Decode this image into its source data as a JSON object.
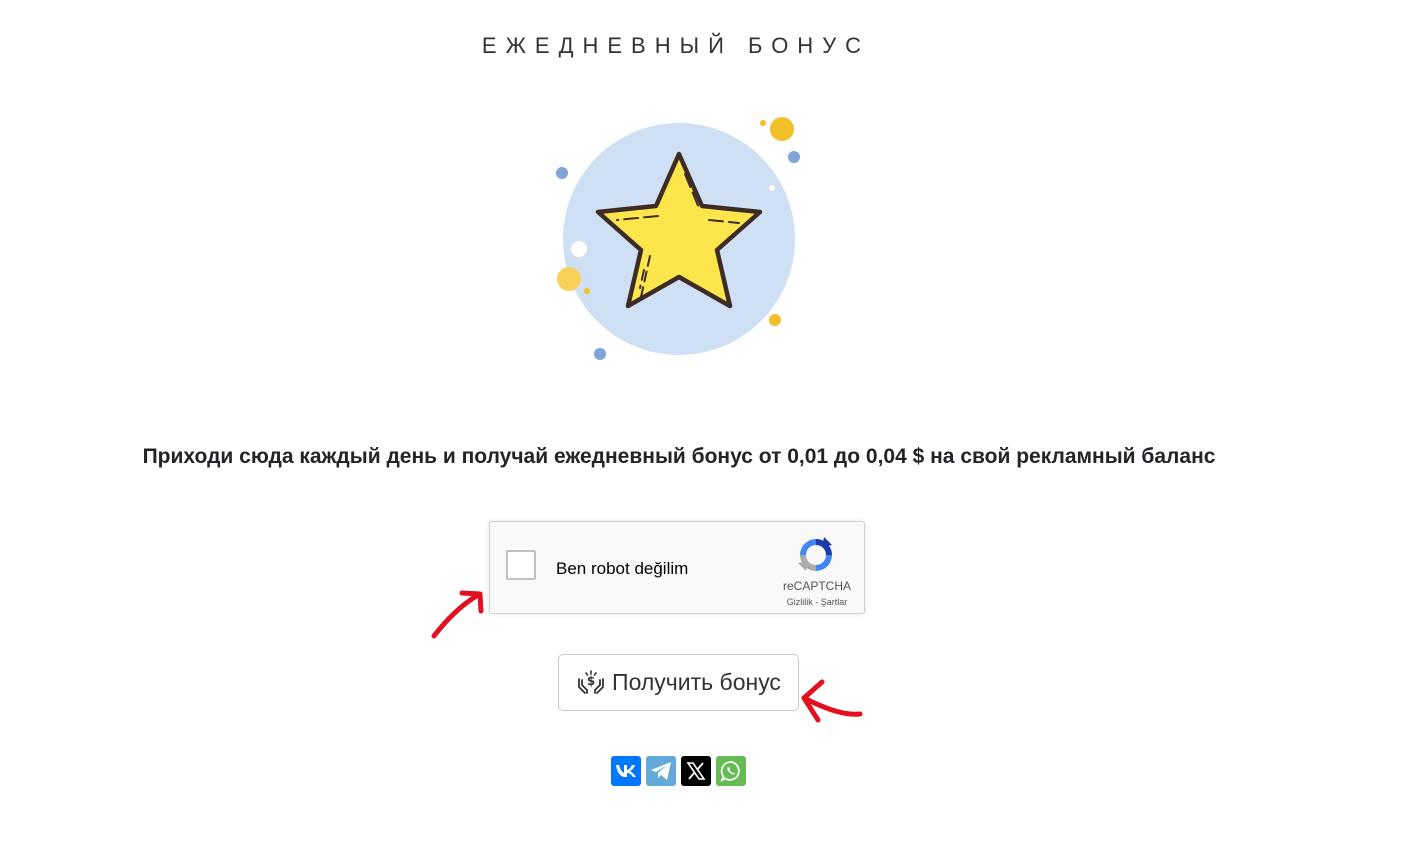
{
  "page": {
    "title": "ЕЖЕДНЕВНЫЙ БОНУС",
    "description": "Приходи сюда каждый день и получай ежедневный бонус от 0,01 до 0,04 $ на свой рекламный баланс"
  },
  "illustration": {
    "icon": "star-icon",
    "circle_color": "#cfe0f5",
    "star_color": "#fde64b",
    "dot_colors": [
      "#f4c02a",
      "#7fa6d6",
      "#ffffff"
    ]
  },
  "recaptcha": {
    "label": "Ben robot değilim",
    "brand": "reCAPTCHA",
    "privacy": "Gizlilik",
    "separator": " - ",
    "terms": "Şartlar"
  },
  "bonus_button": {
    "label": "Получить бонус",
    "icon": "hands-money-icon"
  },
  "share": {
    "buttons": [
      {
        "name": "vk",
        "icon": "vk-icon",
        "color": "#0077ff"
      },
      {
        "name": "telegram",
        "icon": "telegram-icon",
        "color": "#64a9dc"
      },
      {
        "name": "x",
        "icon": "x-icon",
        "color": "#000000"
      },
      {
        "name": "whatsapp",
        "icon": "whatsapp-icon",
        "color": "#65bc54"
      }
    ]
  },
  "annotations": {
    "arrow_color": "#e3101f"
  }
}
